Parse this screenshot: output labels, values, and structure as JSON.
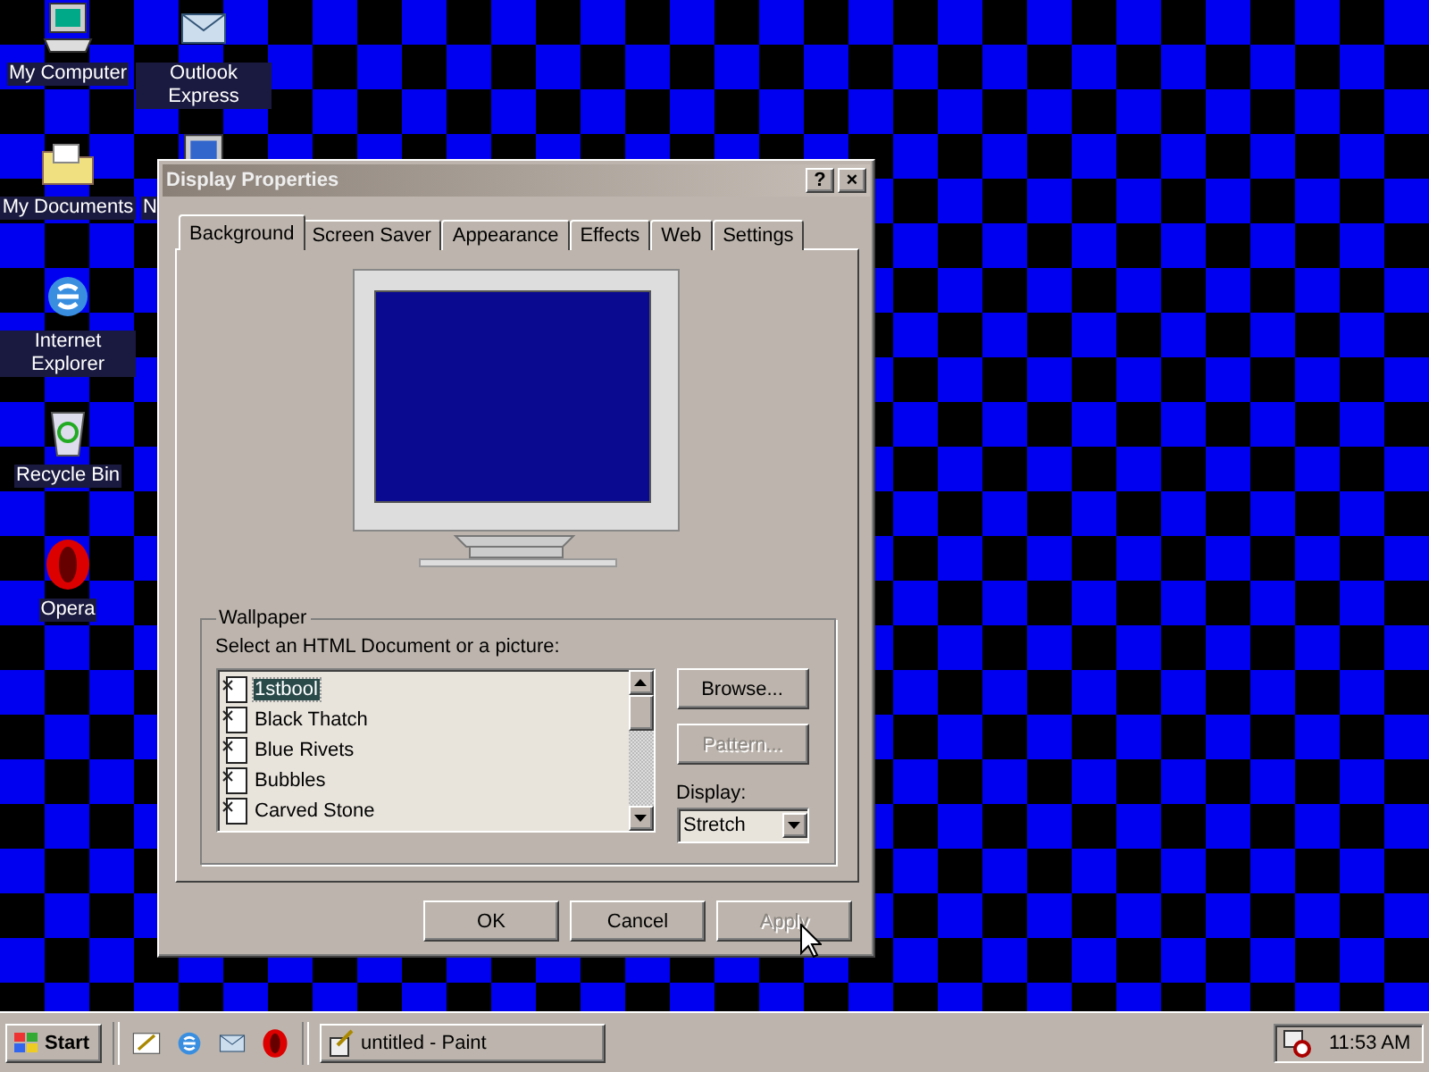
{
  "desktop": {
    "columns": [
      [
        {
          "kind": "computer",
          "label": "My Computer"
        },
        {
          "kind": "documents",
          "label": "My Documents"
        },
        {
          "kind": "browser",
          "label": "Internet Explorer"
        },
        {
          "kind": "recycle",
          "label": "Recycle Bin"
        },
        {
          "kind": "opera",
          "label": "Opera"
        }
      ],
      [
        {
          "kind": "mail",
          "label": "Outlook Express"
        },
        {
          "kind": "network",
          "label": "N"
        }
      ]
    ]
  },
  "window": {
    "title": "Display Properties",
    "help": "?",
    "close": "×",
    "tabs": [
      {
        "label": "Background",
        "selected": true
      },
      {
        "label": "Screen Saver",
        "selected": false
      },
      {
        "label": "Appearance",
        "selected": false
      },
      {
        "label": "Effects",
        "selected": false
      },
      {
        "label": "Web",
        "selected": false
      },
      {
        "label": "Settings",
        "selected": false
      }
    ],
    "wallpaper": {
      "title": "Wallpaper",
      "prompt": "Select an HTML Document or a picture:",
      "items": [
        {
          "label": "1stbool",
          "selected": true
        },
        {
          "label": "Black Thatch",
          "selected": false
        },
        {
          "label": "Blue Rivets",
          "selected": false
        },
        {
          "label": "Bubbles",
          "selected": false
        },
        {
          "label": "Carved Stone",
          "selected": false
        }
      ],
      "side_buttons": [
        {
          "label": "Browse...",
          "disabled": false
        },
        {
          "label": "Pattern...",
          "disabled": true
        }
      ],
      "display_label": "Display:",
      "display_value": "Stretch"
    },
    "buttons": [
      {
        "label": "OK",
        "disabled": false
      },
      {
        "label": "Cancel",
        "disabled": false
      },
      {
        "label": "Apply",
        "disabled": true
      }
    ]
  },
  "taskbar": {
    "start": "Start",
    "quick_launch": [
      {
        "kind": "desktop"
      },
      {
        "kind": "browser"
      },
      {
        "kind": "mail"
      },
      {
        "kind": "opera"
      }
    ],
    "tasks": [
      {
        "label": "untitled - Paint",
        "selected": false
      }
    ],
    "clock": "11:53 AM"
  }
}
